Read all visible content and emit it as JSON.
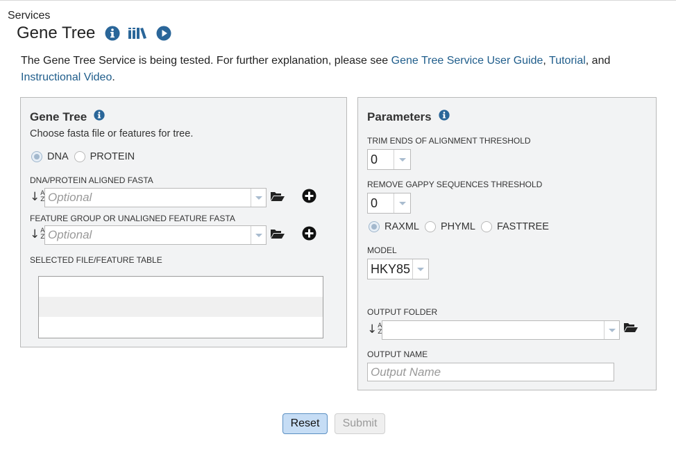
{
  "breadcrumb": "Services",
  "title": "Gene Tree",
  "title_icons": [
    "info-icon",
    "library-icon",
    "play-icon"
  ],
  "intro": {
    "text_before": "The Gene Tree Service is being tested. For further explanation, please see ",
    "link_user_guide": "Gene Tree Service User Guide",
    "sep1": ", ",
    "link_tutorial": "Tutorial",
    "sep2": ", and ",
    "link_video": "Instructional Video",
    "text_after": "."
  },
  "left_panel": {
    "title": "Gene Tree",
    "subtitle": "Choose fasta file or features for tree.",
    "seq_types": {
      "dna": "DNA",
      "protein": "PROTEIN",
      "selected": "DNA"
    },
    "aligned_fasta_label": "DNA/PROTEIN ALIGNED FASTA",
    "aligned_fasta_placeholder": "Optional",
    "feature_group_label": "FEATURE GROUP OR UNALIGNED FEATURE FASTA",
    "feature_group_placeholder": "Optional",
    "table_label": "SELECTED FILE/FEATURE TABLE"
  },
  "right_panel": {
    "title": "Parameters",
    "trim_label": "TRIM ENDS OF ALIGNMENT THRESHOLD",
    "trim_value": "0",
    "gappy_label": "REMOVE GAPPY SEQUENCES THRESHOLD",
    "gappy_value": "0",
    "programs": {
      "raxml": "RAXML",
      "phyml": "PHYML",
      "fasttree": "FASTTREE",
      "selected": "RAXML"
    },
    "model_label": "MODEL",
    "model_value": "HKY85",
    "output_folder_label": "OUTPUT FOLDER",
    "output_folder_value": "",
    "output_name_label": "OUTPUT NAME",
    "output_name_placeholder": "Output Name"
  },
  "buttons": {
    "reset": "Reset",
    "submit": "Submit"
  },
  "colors": {
    "link": "#1f5d8b",
    "icon": "#2a6699",
    "panel_bg": "#f2f3f4",
    "reset_bg": "#c6ddf5"
  }
}
